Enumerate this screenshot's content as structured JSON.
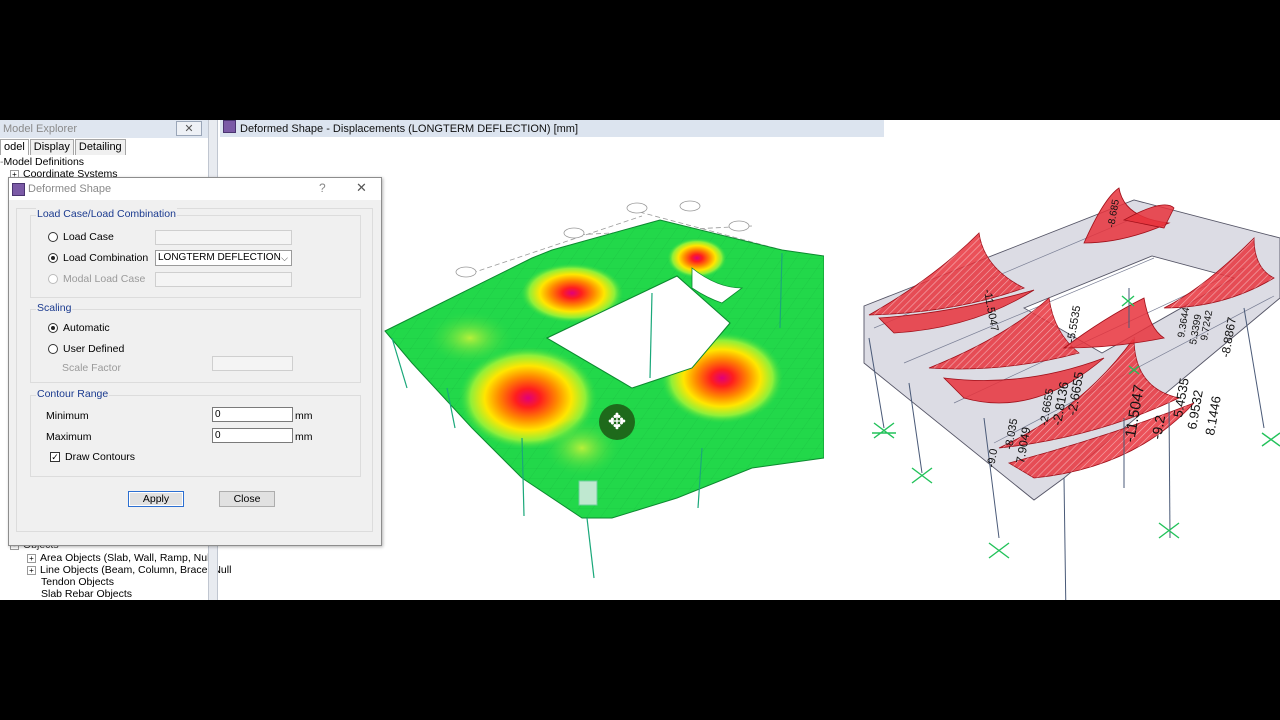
{
  "explorer": {
    "title": "Model Explorer",
    "close_glyph": "✕",
    "tabs": [
      "odel",
      "Display",
      "Detailing"
    ],
    "tree_top": [
      "Model Definitions",
      "Coordinate Systems"
    ],
    "tree_bottom": {
      "objects": "Objects",
      "items": [
        "Area Objects (Slab, Wall, Ramp, Null)",
        "Line Objects (Beam, Column, Brace, Null",
        "Tendon Objects",
        "Slab Rebar Objects"
      ]
    }
  },
  "main_window": {
    "title": "Deformed Shape - Displacements (LONGTERM DEFLECTION)  [mm]"
  },
  "dialog": {
    "title": "Deformed Shape",
    "help_glyph": "?",
    "close_glyph": "✕",
    "load_group": {
      "title": "Load Case/Load Combination",
      "load_case_label": "Load Case",
      "load_combination_label": "Load Combination",
      "load_combination_value": "LONGTERM DEFLECTION",
      "modal_label": "Modal Load Case",
      "selected": "Load Combination"
    },
    "scaling": {
      "title": "Scaling",
      "automatic_label": "Automatic",
      "user_defined_label": "User Defined",
      "scale_factor_label": "Scale Factor",
      "selected": "Automatic"
    },
    "contour": {
      "title": "Contour Range",
      "minimum_label": "Minimum",
      "minimum_value": "0",
      "maximum_label": "Maximum",
      "maximum_value": "0",
      "unit": "mm",
      "draw_contours_label": "Draw Contours",
      "draw_contours_checked": true
    },
    "apply_label": "Apply",
    "close_label": "Close"
  },
  "right_plot": {
    "labels": [
      "-11.5047",
      "-9.2",
      "5.4535",
      "6.9532",
      "8.1446",
      "-2.6655",
      "-2.8136",
      "-5.5535",
      "-2.6655",
      "7.9049",
      "-8.035",
      "-9.0",
      "-8.8867",
      "9.7242",
      "5.3399",
      "9.3644",
      "-11.5047",
      "-8.685"
    ]
  },
  "colors": {
    "contour_green": "#22d84a",
    "contour_red": "#ff1e1e",
    "diagram_red": "#e8323c",
    "support_green": "#22c25a",
    "group_title": "#1a3a8f"
  }
}
